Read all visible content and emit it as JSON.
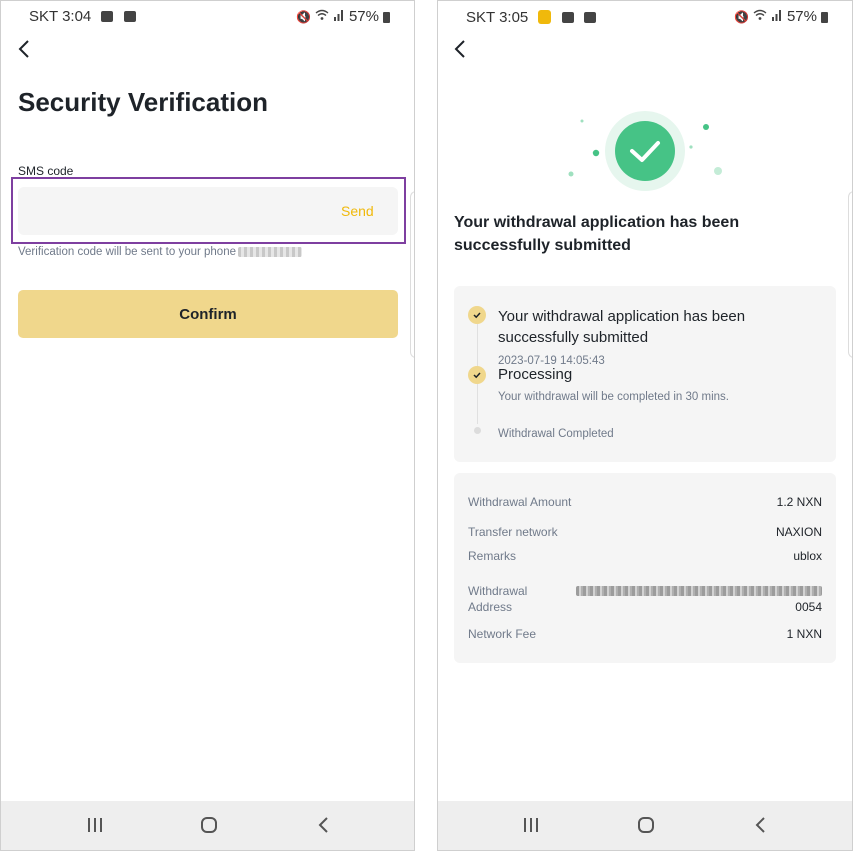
{
  "left": {
    "status": {
      "carrier_time": "SKT 3:04",
      "battery": "57%"
    },
    "title": "Security Verification",
    "sms_label": "SMS code",
    "sms_input": {
      "value": "",
      "placeholder": ""
    },
    "send_label": "Send",
    "hint": "Verification code will be sent to your phone",
    "confirm_label": "Confirm"
  },
  "right": {
    "status": {
      "carrier_time": "SKT 3:05",
      "battery": "57%"
    },
    "success_title": "Your withdrawal application has been successfully submitted",
    "timeline": [
      {
        "title": "Your withdrawal application has been successfully submitted",
        "sub": "2023-07-19 14:05:43",
        "done": true
      },
      {
        "title": "Processing",
        "sub": "Your withdrawal will be completed in 30 mins.",
        "done": true
      },
      {
        "title": "",
        "sub": "Withdrawal Completed",
        "done": false
      }
    ],
    "details": {
      "amount_label": "Withdrawal Amount",
      "amount_value": "1.2 NXN",
      "network_label": "Transfer network",
      "network_value": "NAXION",
      "remarks_label": "Remarks",
      "remarks_value": "ublox",
      "address_label_1": "Withdrawal",
      "address_label_2": "Address",
      "address_value_tail": "0054",
      "fee_label": "Network Fee",
      "fee_value": "1 NXN"
    }
  },
  "colors": {
    "accent": "#f0b90b",
    "confirm_bg": "#f0d78c",
    "success": "#2ebd85",
    "highlight": "#7e3fa0"
  },
  "icons": [
    "back-arrow-icon",
    "wifi-icon",
    "signal-icon",
    "battery-icon",
    "mute-icon",
    "check-icon",
    "recents-icon",
    "home-icon",
    "nav-back-icon"
  ]
}
